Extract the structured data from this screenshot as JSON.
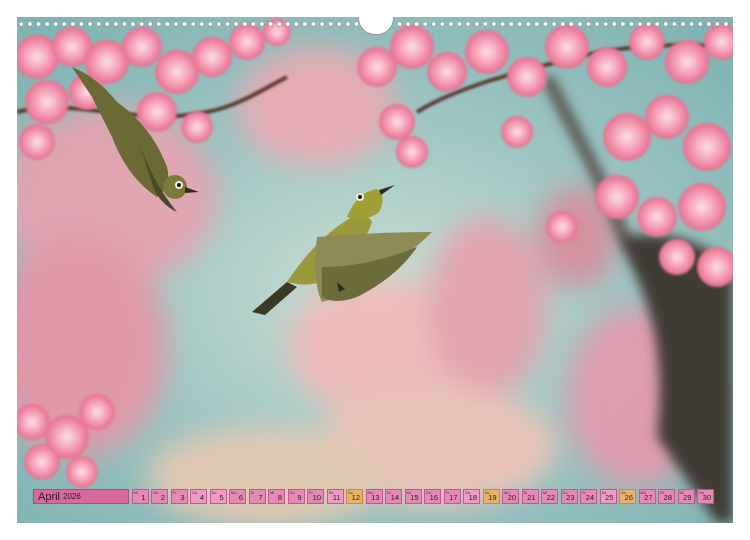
{
  "calendar": {
    "month": "April",
    "year": "2026",
    "days": [
      {
        "n": "1",
        "abbr": "Mi",
        "type": "normal"
      },
      {
        "n": "2",
        "abbr": "Do",
        "type": "normal"
      },
      {
        "n": "3",
        "abbr": "Fr",
        "type": "normal"
      },
      {
        "n": "4",
        "abbr": "Sa",
        "type": "weekend"
      },
      {
        "n": "5",
        "abbr": "So",
        "type": "weekend"
      },
      {
        "n": "6",
        "abbr": "Mo",
        "type": "normal"
      },
      {
        "n": "7",
        "abbr": "Di",
        "type": "normal"
      },
      {
        "n": "8",
        "abbr": "Mi",
        "type": "normal"
      },
      {
        "n": "9",
        "abbr": "Do",
        "type": "normal"
      },
      {
        "n": "10",
        "abbr": "Fr",
        "type": "normal"
      },
      {
        "n": "11",
        "abbr": "Sa",
        "type": "weekend"
      },
      {
        "n": "12",
        "abbr": "So",
        "type": "holiday"
      },
      {
        "n": "13",
        "abbr": "Mo",
        "type": "normal"
      },
      {
        "n": "14",
        "abbr": "Di",
        "type": "normal"
      },
      {
        "n": "15",
        "abbr": "Mi",
        "type": "normal"
      },
      {
        "n": "16",
        "abbr": "Do",
        "type": "normal"
      },
      {
        "n": "17",
        "abbr": "Fr",
        "type": "normal"
      },
      {
        "n": "18",
        "abbr": "Sa",
        "type": "weekend"
      },
      {
        "n": "19",
        "abbr": "So",
        "type": "holiday"
      },
      {
        "n": "20",
        "abbr": "Mo",
        "type": "normal"
      },
      {
        "n": "21",
        "abbr": "Di",
        "type": "normal"
      },
      {
        "n": "22",
        "abbr": "Mi",
        "type": "normal"
      },
      {
        "n": "23",
        "abbr": "Do",
        "type": "normal"
      },
      {
        "n": "24",
        "abbr": "Fr",
        "type": "normal"
      },
      {
        "n": "25",
        "abbr": "Sa",
        "type": "weekend"
      },
      {
        "n": "26",
        "abbr": "So",
        "type": "holiday"
      },
      {
        "n": "27",
        "abbr": "Mo",
        "type": "normal"
      },
      {
        "n": "28",
        "abbr": "Di",
        "type": "normal"
      },
      {
        "n": "29",
        "abbr": "Mi",
        "type": "normal"
      },
      {
        "n": "30",
        "abbr": "Do",
        "type": "normal"
      }
    ]
  },
  "colors": {
    "blossom": "#f08aa8",
    "sky": "#b7d6d0",
    "bird": "#8a8a3a",
    "strip": "#e789b6",
    "holiday": "#e8b26b"
  }
}
